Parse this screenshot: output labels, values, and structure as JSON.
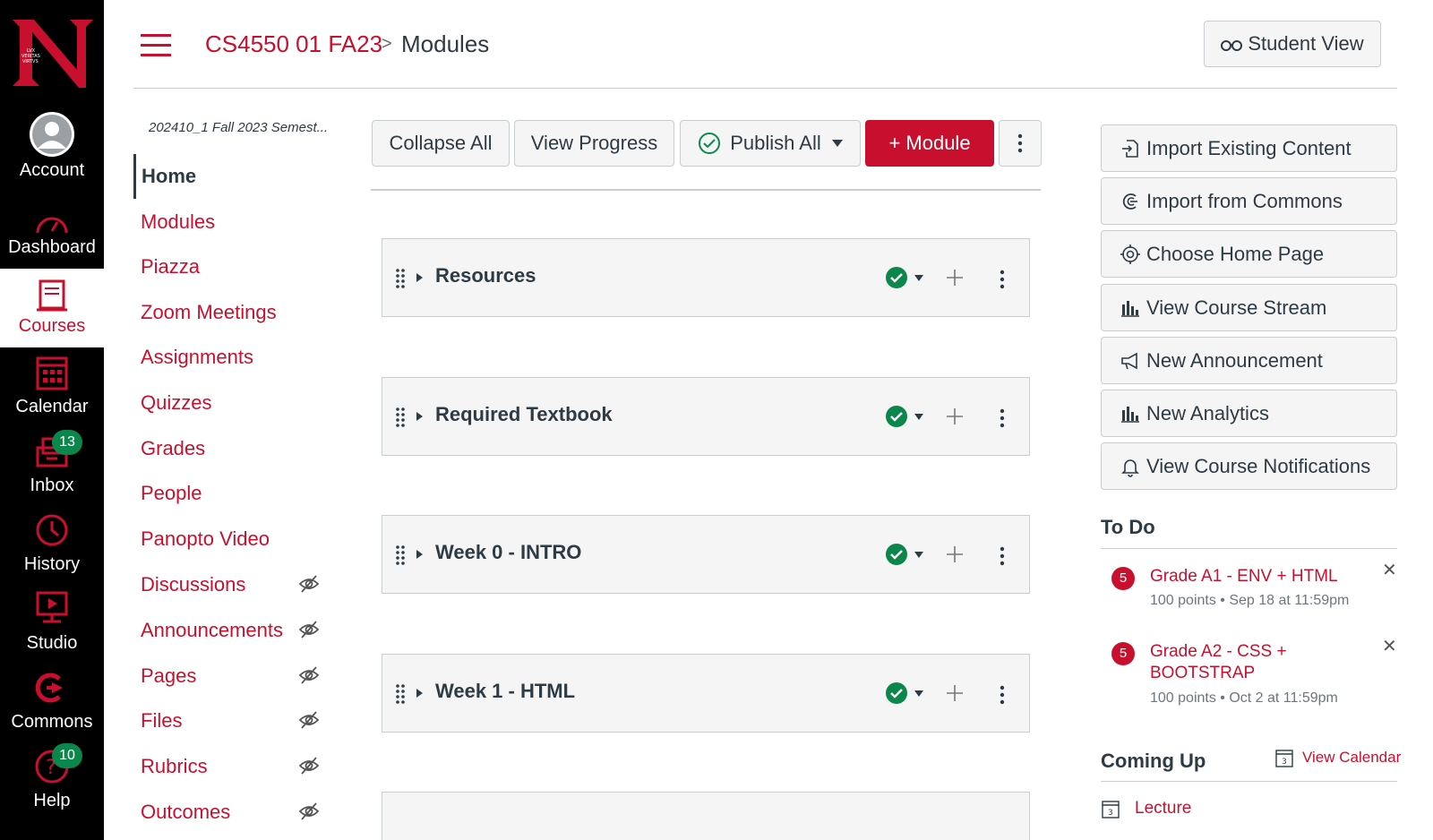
{
  "global_nav": {
    "items": [
      {
        "label": "Account",
        "icon": "avatar-icon"
      },
      {
        "label": "Dashboard",
        "icon": "dashboard-icon"
      },
      {
        "label": "Courses",
        "icon": "courses-icon"
      },
      {
        "label": "Calendar",
        "icon": "calendar-icon"
      },
      {
        "label": "Inbox",
        "icon": "inbox-icon",
        "badge": "13"
      },
      {
        "label": "History",
        "icon": "clock-icon"
      },
      {
        "label": "Studio",
        "icon": "studio-icon"
      },
      {
        "label": "Commons",
        "icon": "commons-icon"
      },
      {
        "label": "Help",
        "icon": "help-icon",
        "badge": "10"
      }
    ],
    "logo_text": "LVX VERITAS VIRTVS"
  },
  "header": {
    "course": "CS4550 01 FA23",
    "separator": ">",
    "current": "Modules",
    "student_view": "Student View"
  },
  "course_nav": {
    "semester": "202410_1 Fall 2023 Semest...",
    "items": [
      {
        "label": "Home",
        "active": true
      },
      {
        "label": "Modules"
      },
      {
        "label": "Piazza"
      },
      {
        "label": "Zoom Meetings"
      },
      {
        "label": "Assignments"
      },
      {
        "label": "Quizzes"
      },
      {
        "label": "Grades"
      },
      {
        "label": "People"
      },
      {
        "label": "Panopto Video"
      },
      {
        "label": "Discussions",
        "hidden": true
      },
      {
        "label": "Announcements",
        "hidden": true
      },
      {
        "label": "Pages",
        "hidden": true
      },
      {
        "label": "Files",
        "hidden": true
      },
      {
        "label": "Rubrics",
        "hidden": true
      },
      {
        "label": "Outcomes",
        "hidden": true
      }
    ]
  },
  "toolbar": {
    "collapse_all": "Collapse All",
    "view_progress": "View Progress",
    "publish_all": "Publish All",
    "add_module": "+ Module"
  },
  "modules": [
    {
      "title": "Resources"
    },
    {
      "title": "Required Textbook"
    },
    {
      "title": "Week 0 - INTRO"
    },
    {
      "title": "Week 1 - HTML"
    }
  ],
  "sidebar": {
    "buttons": [
      {
        "label": "Import Existing Content",
        "icon": "import-icon"
      },
      {
        "label": "Import from Commons",
        "icon": "commons-icon"
      },
      {
        "label": "Choose Home Page",
        "icon": "target-icon"
      },
      {
        "label": "View Course Stream",
        "icon": "bar-chart-icon"
      },
      {
        "label": "New Announcement",
        "icon": "megaphone-icon"
      },
      {
        "label": "New Analytics",
        "icon": "bar-chart-icon"
      },
      {
        "label": "View Course Notifications",
        "icon": "bell-icon"
      }
    ],
    "todo_heading": "To Do",
    "todos": [
      {
        "badge": "5",
        "title": "Grade A1 - ENV + HTML",
        "meta": "100 points • Sep 18 at 11:59pm"
      },
      {
        "badge": "5",
        "title": "Grade A2 - CSS + BOOTSTRAP",
        "meta": "100 points • Oct 2 at 11:59pm"
      }
    ],
    "coming_up_heading": "Coming Up",
    "view_calendar": "View Calendar",
    "calendar_day": "3",
    "coming_up_items": [
      {
        "title": "Lecture"
      }
    ]
  },
  "colors": {
    "brand": "#c8102e",
    "nav_bg": "#000000",
    "published": "#0b874b"
  }
}
